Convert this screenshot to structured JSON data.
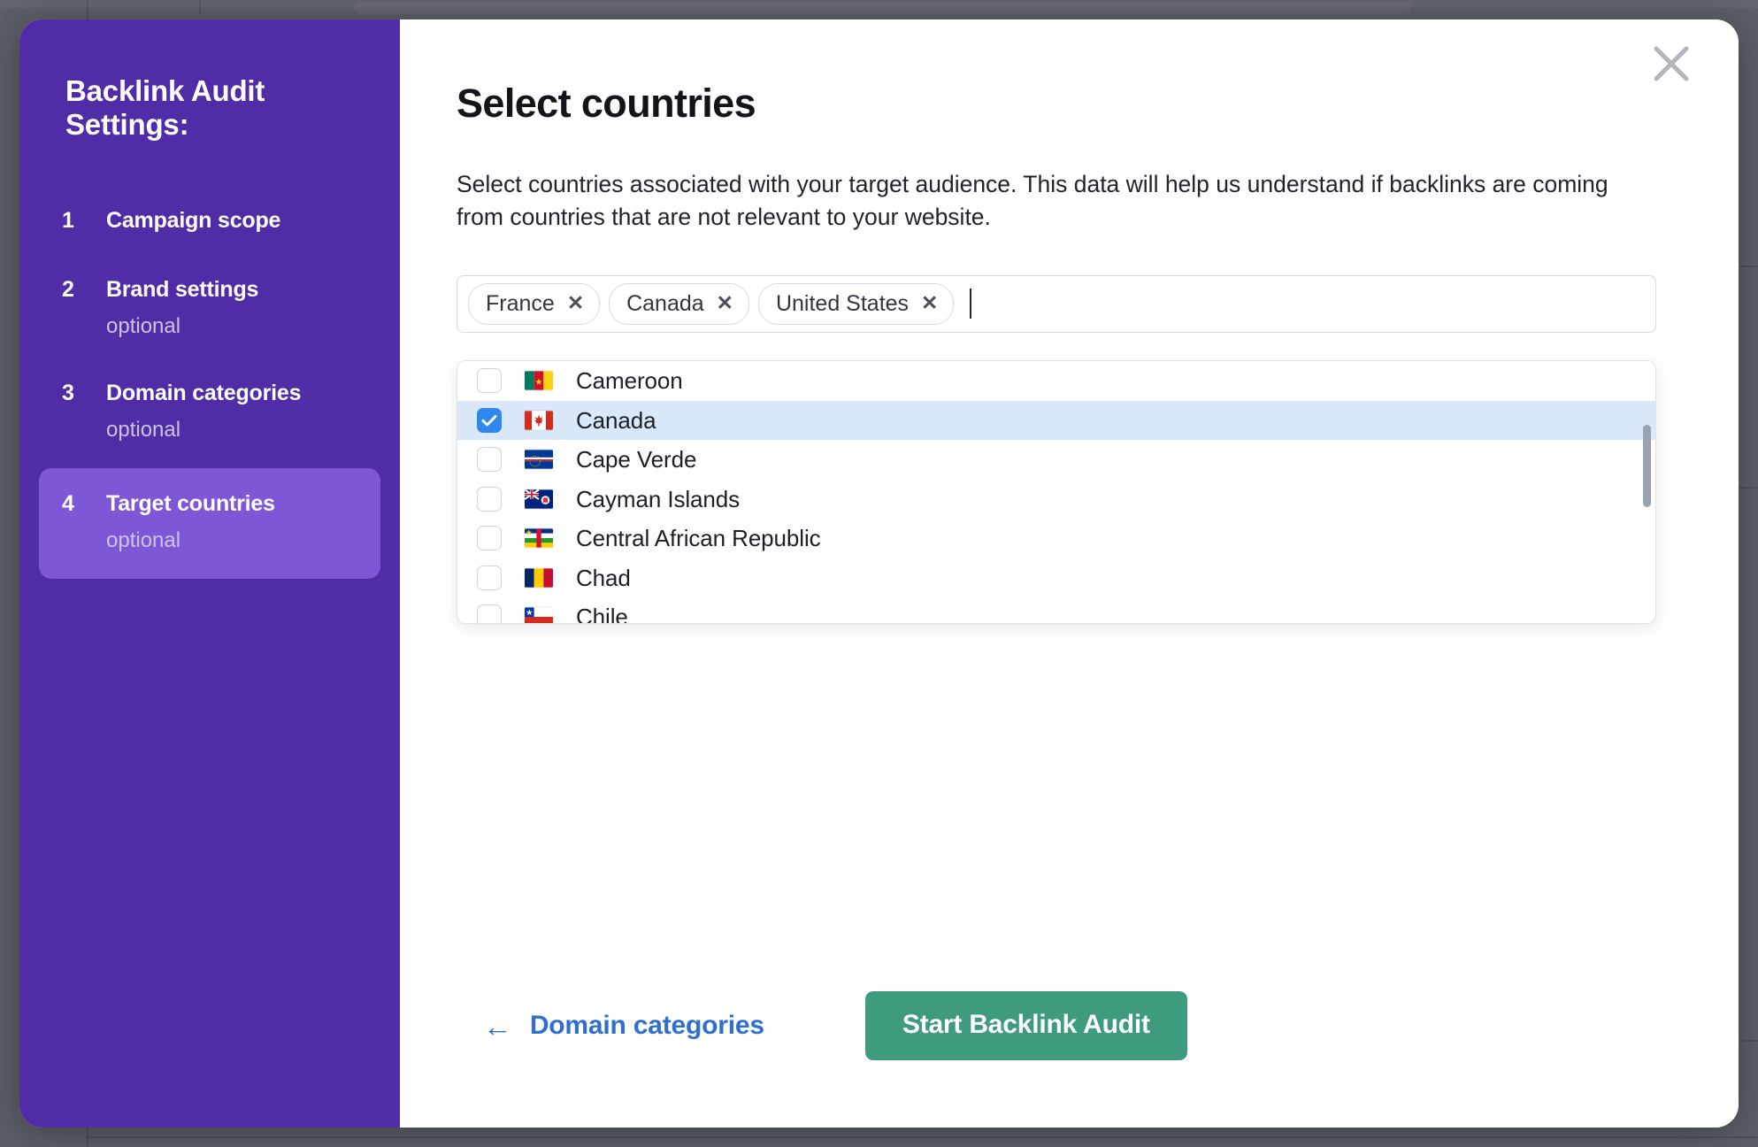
{
  "sidebar": {
    "title": "Backlink Audit\nSettings:",
    "steps": [
      {
        "num": "1",
        "label": "Campaign scope",
        "optional": ""
      },
      {
        "num": "2",
        "label": "Brand settings",
        "optional": "optional"
      },
      {
        "num": "3",
        "label": "Domain categories",
        "optional": "optional"
      },
      {
        "num": "4",
        "label": "Target countries",
        "optional": "optional"
      }
    ]
  },
  "main": {
    "title": "Select countries",
    "description": "Select countries associated with your target audience. This data will help us understand if backlinks are coming from countries that are not relevant to your website.",
    "close_icon": "close-icon"
  },
  "tag_input": {
    "tags": [
      {
        "label": "France",
        "remove": "✕"
      },
      {
        "label": "Canada",
        "remove": "✕"
      },
      {
        "label": "United States",
        "remove": "✕"
      }
    ],
    "value": "",
    "placeholder": ""
  },
  "dropdown": {
    "items": [
      {
        "label": "Cameroon",
        "flag": "cm",
        "checked": false
      },
      {
        "label": "Canada",
        "flag": "ca",
        "checked": true
      },
      {
        "label": "Cape Verde",
        "flag": "cv",
        "checked": false
      },
      {
        "label": "Cayman Islands",
        "flag": "ky",
        "checked": false
      },
      {
        "label": "Central African Republic",
        "flag": "cf",
        "checked": false
      },
      {
        "label": "Chad",
        "flag": "td",
        "checked": false
      },
      {
        "label": "Chile",
        "flag": "cl",
        "checked": false
      }
    ]
  },
  "footer": {
    "back_arrow": "←",
    "back_label": "Domain categories",
    "primary_label": "Start Backlink Audit"
  },
  "colors": {
    "sidebar_bg": "#502ca7",
    "sidebar_active": "#7e57d6",
    "primary_button": "#3f9b7e",
    "link": "#2f6fd0",
    "checkbox_checked": "#2f88ef",
    "row_selected": "#d9e9f9",
    "backdrop": "#5c5e66"
  }
}
